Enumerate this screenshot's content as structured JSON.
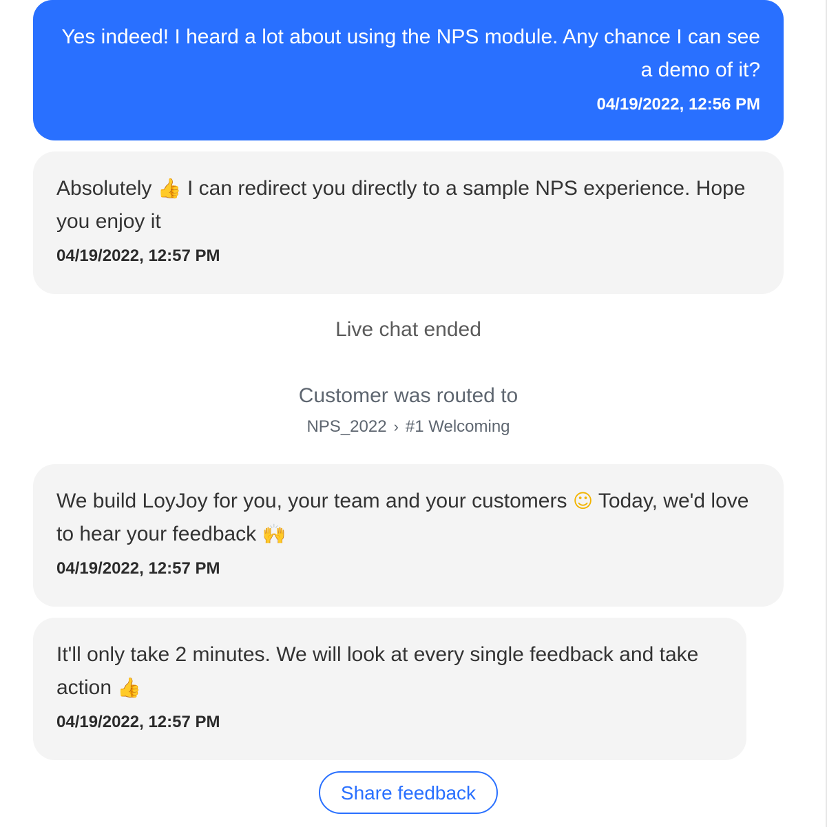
{
  "messages": [
    {
      "text": "Yes indeed! I heard a lot about using the NPS module. Any chance I can see a demo of it?",
      "timestamp": "04/19/2022, 12:56 PM"
    },
    {
      "text_before": "Absolutely",
      "text_after": "I can redirect you directly to a sample NPS experience. Hope you enjoy it",
      "emoji": "thumbs-up-emoji",
      "timestamp": "04/19/2022, 12:57 PM"
    },
    {
      "text_before": "We build LoyJoy for you, your team and your customers",
      "text_middle": "Today, we'd love to hear your feedback",
      "emoji_1": "smiling-face-emoji",
      "emoji_2": "raising-hands-emoji",
      "timestamp": "04/19/2022, 12:57 PM"
    },
    {
      "text_before": "It'll only take 2 minutes. We will look at every single feedback and take action",
      "emoji": "thumbs-up-emoji",
      "timestamp": "04/19/2022, 12:57 PM"
    }
  ],
  "system": {
    "live_chat_ended": "Live chat ended",
    "routed_title": "Customer was routed to",
    "routed_flow": "NPS_2022",
    "routed_step": "#1 Welcoming"
  },
  "actions": {
    "share_feedback_label": "Share feedback"
  },
  "colors": {
    "outgoing_bubble": "#2970ff",
    "incoming_bubble": "#f4f4f4",
    "accent": "#2970ff"
  }
}
